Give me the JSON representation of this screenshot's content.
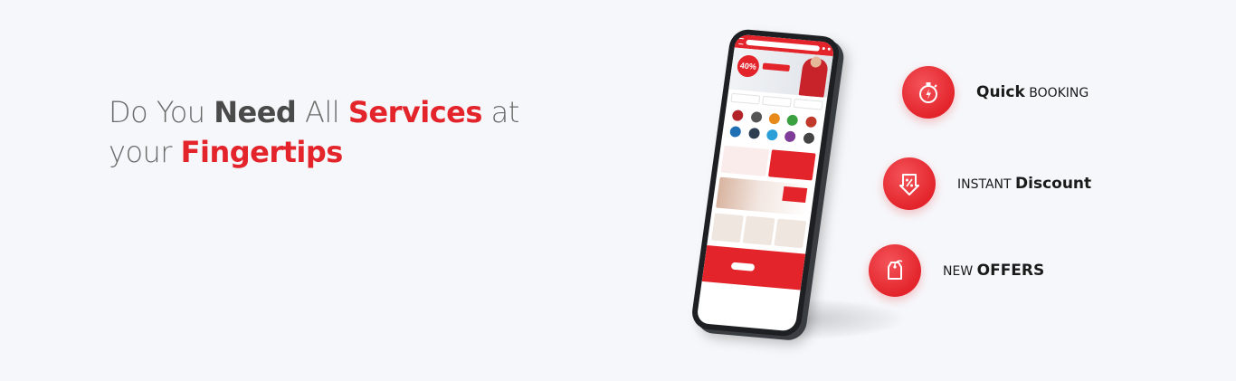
{
  "headline": {
    "line1": {
      "w1": "Do You",
      "w2": "Need",
      "w3": "All",
      "w4": "Services",
      "w5": "at"
    },
    "line2": {
      "w1": "your",
      "w2": "Fingertips"
    }
  },
  "phone_screen": {
    "banner_badge": "40%"
  },
  "features": [
    {
      "strong": "Quick",
      "plain": "BOOKING",
      "icon": "stopwatch-icon"
    },
    {
      "plain": "INSTANT",
      "strong": "Discount",
      "icon": "discount-tag-icon"
    },
    {
      "plain": "NEW",
      "strong": "OFFERS",
      "icon": "price-tag-icon"
    }
  ],
  "colors": {
    "accent": "#e3242b",
    "background": "#f6f7fa",
    "text_gray": "#6b6b6b",
    "text_dark": "#4a4a4a"
  }
}
